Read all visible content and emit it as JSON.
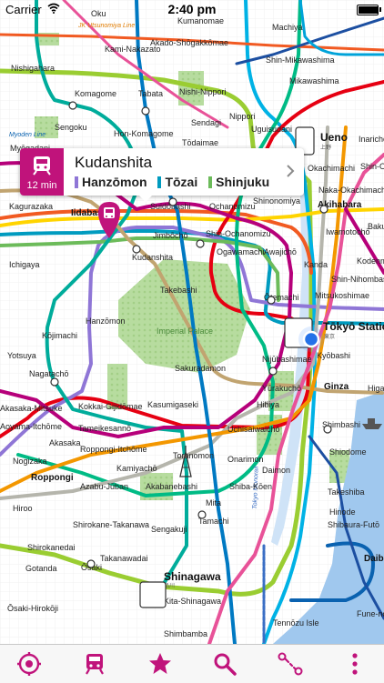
{
  "status_bar": {
    "carrier": "Carrier",
    "time": "2:40 pm",
    "battery_level": 0.95
  },
  "callout": {
    "station": "Kudanshita",
    "travel_time": "12 min",
    "lines": [
      {
        "name": "Hanzōmon",
        "color": "#8f76d6"
      },
      {
        "name": "Tōzai",
        "color": "#009bbf"
      },
      {
        "name": "Shinjuku",
        "color": "#6cbb5a"
      }
    ],
    "accent_color": "#c0137b"
  },
  "map_labels": {
    "oku": "Oku",
    "kumanomae": "Kumanomae",
    "machiya": "Machiya",
    "jk_utsunomiya": "JK Utsunomiya Line",
    "kami_nakazato": "Kami-Nakazato",
    "akado": "Akado-Shōgakkōmae",
    "shin_mikawashima": "Shin-Mikawashima",
    "nishigahara": "Nishigahara",
    "mikawashima": "Mikawashima",
    "komagome": "Komagome",
    "tabata": "Tabata",
    "nishi_nippori": "Nishi-Nippori",
    "sengoku": "Sengoku",
    "sendagi": "Sendagi",
    "nippori": "Nippori",
    "hon_komagome": "Hon-Komagome",
    "todaimae": "Tōdaimae",
    "uguisudani": "Uguisudani",
    "ueno": "Ueno",
    "ueno_jp": "上野",
    "inaricho": "Inarichō",
    "okachimachi": "Okachimachi",
    "shin_okachimachi": "Shin-Okachimachi",
    "naka_okachimachi": "Naka-Okachimachi",
    "akihabara": "Akihabara",
    "myogadani": "Myōgadani",
    "kagurazaka": "Kagurazaka",
    "iidabashi": "Iidabashi",
    "suidobashi": "Suidōbashi",
    "ochanomizu": "Ochanomizu",
    "shin_ochanomizu": "Shin-Ochanomizu",
    "shinonomiya": "Shinonomiya",
    "jimbocho": "Jimbōchō",
    "ogawamachi": "Ogawamachi",
    "awajicho": "Awajichō",
    "iwamotocho": "Iwamotochō",
    "bakuro": "Bakuro",
    "ichigaya": "Ichigaya",
    "kudanshita": "Kudanshita",
    "kanda": "Kanda",
    "shin_nihombashi": "Shin-Nihombashi",
    "kodenma": "Kodenma",
    "takebashi": "Takebashi",
    "otemachi": "Ōtemachi",
    "mitsukoshimae": "Mitsukoshimae",
    "kojimachi": "Kōjimachi",
    "hanzomon": "Hanzōmon",
    "imperial_palace": "Imperial Palace",
    "tokyo_station": "Tōkyō Station",
    "tokyo_jp": "東京",
    "yotsuya": "Yotsuya",
    "sakuradamon": "Sakuradamon",
    "nijubashimae": "Nijūbashimae",
    "kyobashi": "Kyōbashi",
    "nagatacho": "Nagatachō",
    "yurakucho": "Yūrakuchō",
    "ginza": "Ginza",
    "higashi_ginza": "Higas",
    "akasaka_mitsuke": "Akasaka-Mitsuke",
    "kokkai": "Kokkai-Gijidōmae",
    "kasumigaseki": "Kasumigaseki",
    "hibiya": "Hibiya",
    "aoyama": "Aoyama-Itchōme",
    "tameikesanno": "Tameikesannō",
    "uchisaiwaicho": "Uchisaiwaichō",
    "shimbashi": "Shimbashi",
    "akasaka": "Akasaka",
    "roppongi_itchome": "Roppongi-Itchōme",
    "toranomon": "Toranomon",
    "shiodome": "Shiodome",
    "nogizaka": "Nogizaka",
    "onarimon": "Onarimon",
    "roppongi": "Roppongi",
    "kamiyacho": "Kamiyachō",
    "daimon": "Daimon",
    "azabu_juban": "Azabu-Jūban",
    "akabanebashi": "Akabanebashi",
    "shiba_koen": "Shiba-Kōen",
    "takeshiba": "Takeshiba",
    "hiroo": "Hiroo",
    "mita": "Mita",
    "hinode": "Hinode",
    "shirokane_takanawa": "Shirokane-Takanawa",
    "sengakuji": "Sengakuji",
    "tamachi": "Tamachi",
    "shibaura_futo": "Shibaura-Futō",
    "shirokanedai": "Shirokanedai",
    "takanawadai": "Takanawadai",
    "daiba": "Daiba",
    "gotanda": "Gotanda",
    "osaki": "Ōsaki",
    "shinagawa": "Shinagawa",
    "shinagawa_jp": "品川",
    "osaki_hirokoji": "Ōsaki-Hirokōji",
    "kita_shinagawa": "Kita-Shinagawa",
    "fune_no": "Fune-no-",
    "shimbamba": "Shimbamba",
    "tennozu": "Tennōzu Isle",
    "tokyo_monorail": "Tokyo Monorail",
    "myoden_line": "Myoden Line"
  },
  "colors": {
    "yamanote": "#9acd32",
    "chuo": "#f15a22",
    "sobu": "#ffd400",
    "marunouchi": "#e60012",
    "tozai": "#009bbf",
    "hanzomon": "#8f76d6",
    "namboku": "#00ac9b",
    "yurakucho": "#c1a470",
    "chiyoda": "#00bb85",
    "hibiya": "#b5b5ac",
    "ginza": "#f39700",
    "shinjuku": "#6cbb5a",
    "mita": "#0079c2",
    "asakusa": "#e85298",
    "oedo": "#b6007a",
    "keihin": "#00b2e5",
    "park": "#a9d28f",
    "water": "#a0c8ee"
  },
  "toolbar": {
    "location": "locate-icon",
    "stations": "train-icon",
    "favourites": "star-icon",
    "search": "search-icon",
    "route": "route-icon",
    "more": "more-icon"
  }
}
